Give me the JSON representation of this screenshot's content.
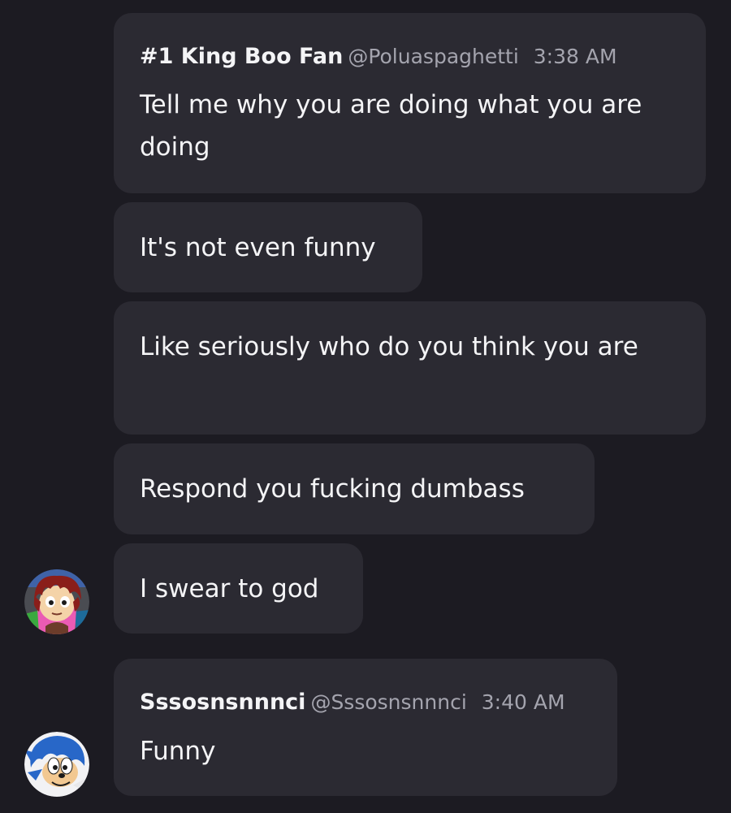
{
  "messages": [
    {
      "author": "#1 King Boo Fan",
      "handle": "@Poluaspaghetti",
      "time": "3:38 AM",
      "text": "Tell me why you are doing what you are doing"
    },
    {
      "text": "It's not even funny"
    },
    {
      "text": "Like seriously who do you think you are"
    },
    {
      "text": "Respond you fucking dumbass"
    },
    {
      "text": "I swear to god"
    },
    {
      "author": "Sssosnsnnnci",
      "handle": "@Sssosnsnnnci",
      "time": "3:40 AM",
      "text": "Funny"
    }
  ],
  "avatars": {
    "first": "red-haired-character-avatar",
    "second": "blue-hedgehog-avatar"
  },
  "colors": {
    "background": "#1c1b22",
    "bubble": "#2b2a32",
    "text": "#f4f4f6",
    "muted": "#a4a4ae"
  }
}
